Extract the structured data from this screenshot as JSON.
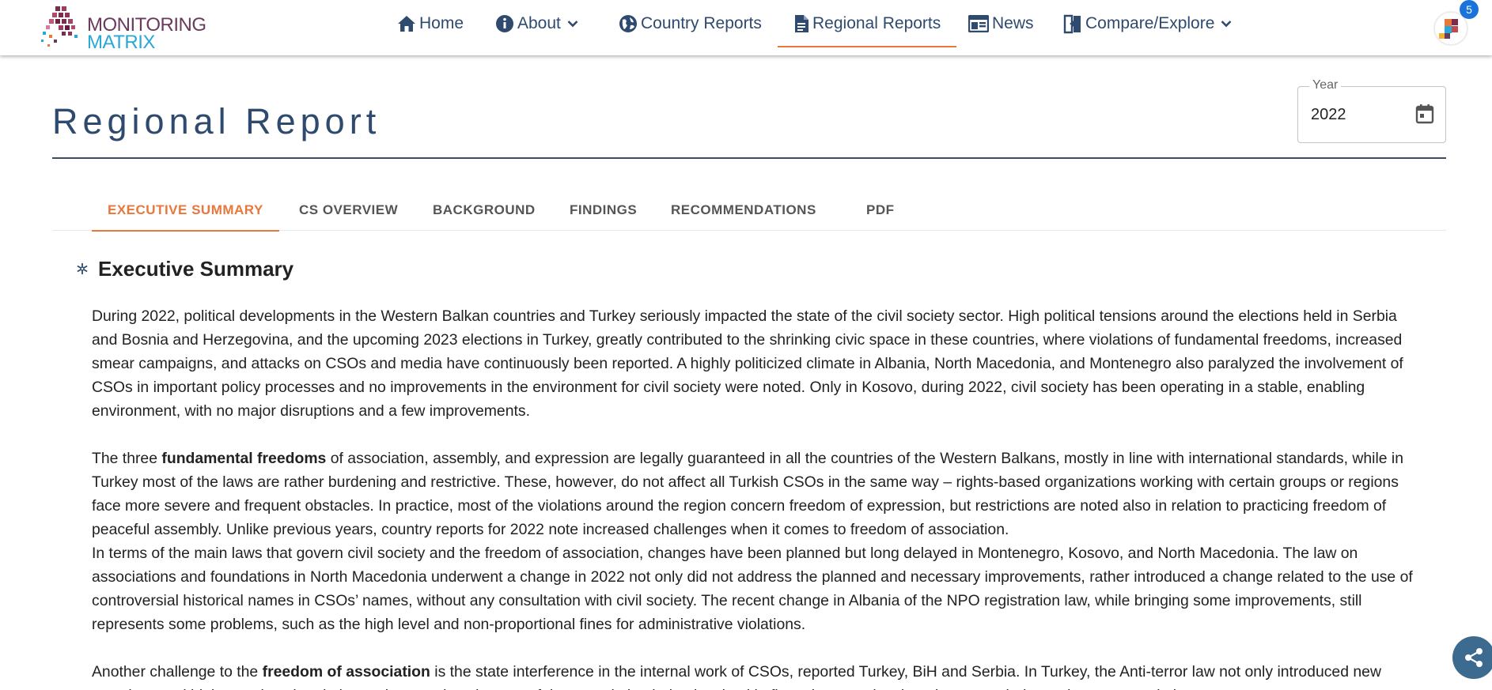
{
  "logo": {
    "line1": "MONITORING",
    "line2": "MATRIX"
  },
  "nav": {
    "home": "Home",
    "about": "About",
    "country_reports": "Country Reports",
    "regional_reports": "Regional Reports",
    "news": "News",
    "compare": "Compare/Explore",
    "notification_count": "5"
  },
  "page": {
    "title": "Regional Report"
  },
  "year": {
    "label": "Year",
    "value": "2022"
  },
  "tabs": [
    {
      "label": "EXECUTIVE SUMMARY"
    },
    {
      "label": "CS OVERVIEW"
    },
    {
      "label": "BACKGROUND"
    },
    {
      "label": "FINDINGS"
    },
    {
      "label": "RECOMMENDATIONS"
    },
    {
      "label": "PDF"
    }
  ],
  "section": {
    "heading": "Executive Summary",
    "p1": "During 2022, political developments in the Western Balkan countries and Turkey seriously impacted the state of the civil society sector. High political tensions around the elections held in Serbia and Bosnia and Herzegovina, and the upcoming 2023 elections in Turkey, greatly contributed to the shrinking civic space in these countries, where violations of fundamental freedoms, increased smear campaigns, and attacks on CSOs and media have continuously been reported. A highly politicized climate in Albania, North Macedonia, and Montenegro also paralyzed the involvement of CSOs in important policy processes and no improvements in the environment for civil society were noted. Only in Kosovo, during 2022, civil society has been operating in a stable, enabling environment, with no major disruptions and a few improvements.",
    "p2_pre": "The three ",
    "p2_bold": "fundamental freedoms",
    "p2_post": " of association, assembly, and expression are legally guaranteed in all the countries of the Western Balkans, mostly in line with international standards, while in Turkey most of the laws are rather burdening and restrictive. These, however, do not affect all Turkish CSOs in the same way – rights-based organizations working with certain groups or regions face more severe and frequent obstacles. In practice, most of the violations around the region concern freedom of expression, but restrictions are noted also in relation to practicing freedom of peaceful assembly. Unlike previous years, country reports for 2022 note increased challenges when it comes to freedom of association.",
    "p3": "In terms of the main laws that govern civil society and the freedom of association, changes have been planned but long delayed in Montenegro, Kosovo, and North Macedonia. The law on associations and foundations in North Macedonia underwent a change in 2022 not only did not address the planned and necessary improvements, rather introduced a change related to the use of controversial historical names in CSOs’ names, without any consultation with civil society. The recent change in Albania of the NPO registration law, while bringing some improvements, still represents some problems, such as the high level and non-proportional fines for administrative violations.",
    "p4_pre": "Another challenge to the ",
    "p4_bold": "freedom of association",
    "p4_post": " is the state interference in the internal work of CSOs, reported Turkey, BiH and Serbia. In Turkey, the Anti-terror law not only introduced new sanctions and high sanctions in relation to the sanctions in case of the association being involved in financing terrorism but also expanded sanctions to associations"
  }
}
